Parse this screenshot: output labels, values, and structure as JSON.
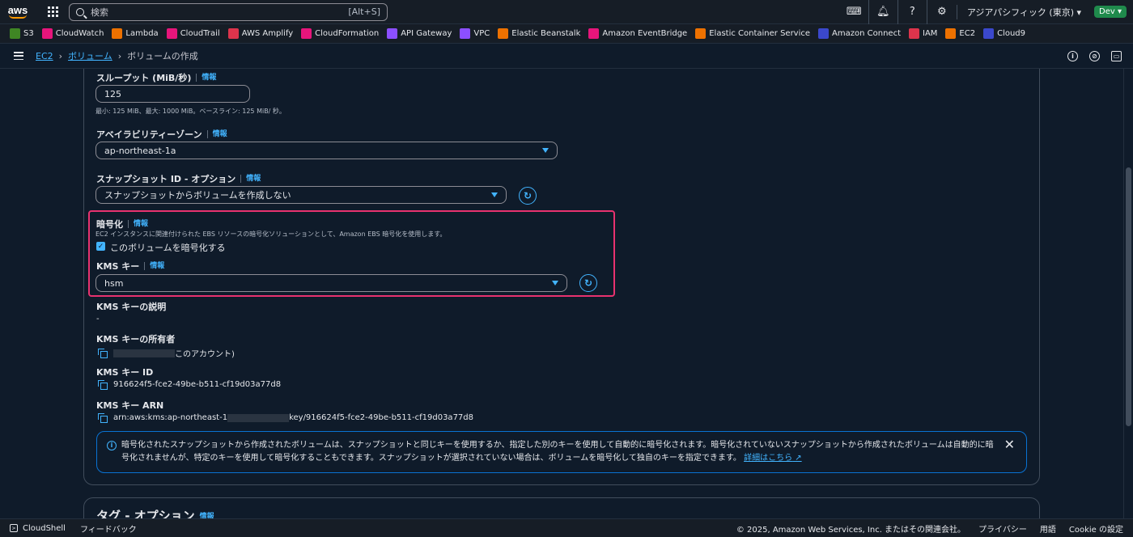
{
  "topnav": {
    "logo": "aws",
    "search_placeholder": "検索",
    "search_shortcut": "[Alt+S]",
    "region": "アジアパシフィック (東京) ▾",
    "account": "Dev ▾"
  },
  "favorites": [
    {
      "label": "S3",
      "color": "#3f8624"
    },
    {
      "label": "CloudWatch",
      "color": "#e7157b"
    },
    {
      "label": "Lambda",
      "color": "#ed7100"
    },
    {
      "label": "CloudTrail",
      "color": "#e7157b"
    },
    {
      "label": "AWS Amplify",
      "color": "#dd344c"
    },
    {
      "label": "CloudFormation",
      "color": "#e7157b"
    },
    {
      "label": "API Gateway",
      "color": "#8c4fff"
    },
    {
      "label": "VPC",
      "color": "#8c4fff"
    },
    {
      "label": "Elastic Beanstalk",
      "color": "#ed7100"
    },
    {
      "label": "Amazon EventBridge",
      "color": "#e7157b"
    },
    {
      "label": "Elastic Container Service",
      "color": "#ed7100"
    },
    {
      "label": "Amazon Connect",
      "color": "#3b48cc"
    },
    {
      "label": "IAM",
      "color": "#dd344c"
    },
    {
      "label": "EC2",
      "color": "#ed7100"
    },
    {
      "label": "Cloud9",
      "color": "#3b48cc"
    }
  ],
  "breadcrumb": {
    "ec2": "EC2",
    "volumes": "ボリューム",
    "current": "ボリュームの作成"
  },
  "form": {
    "throughput": {
      "label": "スループット (MiB/秒)",
      "info": "情報",
      "value": "125",
      "hint": "最小: 125 MiB、最大: 1000 MiB。ベースライン: 125 MiB/ 秒。"
    },
    "az": {
      "label": "アベイラビリティーゾーン",
      "info": "情報",
      "value": "ap-northeast-1a"
    },
    "snapshot": {
      "label": "スナップショット ID - オプション",
      "info": "情報",
      "value": "スナップショットからボリュームを作成しない"
    },
    "encryption": {
      "label": "暗号化",
      "info": "情報",
      "desc": "EC2 インスタンスに関連付けられた EBS リソースの暗号化ソリューションとして、Amazon EBS 暗号化を使用します。",
      "checkbox_label": "このボリュームを暗号化する"
    },
    "kms_key": {
      "label": "KMS キー",
      "info": "情報",
      "value": "hsm"
    },
    "kms_desc": {
      "label": "KMS キーの説明",
      "value": "-"
    },
    "kms_owner": {
      "label": "KMS キーの所有者",
      "value": "このアカウント)"
    },
    "kms_id": {
      "label": "KMS キー ID",
      "value": "916624f5-fce2-49be-b511-cf19d03a77d8"
    },
    "kms_arn": {
      "label": "KMS キー ARN",
      "prefix": "arn:aws:kms:ap-northeast-1",
      "suffix": "key/916624f5-fce2-49be-b511-cf19d03a77d8"
    }
  },
  "alert": {
    "text": "暗号化されたスナップショットから作成されたボリュームは、スナップショットと同じキーを使用するか、指定した別のキーを使用して自動的に暗号化されます。暗号化されていないスナップショットから作成されたボリュームは自動的に暗号化されませんが、特定のキーを使用して暗号化することもできます。スナップショットが選択されていない場合は、ボリュームを暗号化して独自のキーを指定できます。",
    "link": "詳細はこちら"
  },
  "tags_section": {
    "title": "タグ - オプション",
    "info": "情報"
  },
  "footer": {
    "cloudshell": "CloudShell",
    "feedback": "フィードバック",
    "copyright": "© 2025, Amazon Web Services, Inc. またはその関連会社。",
    "privacy": "プライバシー",
    "terms": "用語",
    "cookie": "Cookie の設定"
  }
}
